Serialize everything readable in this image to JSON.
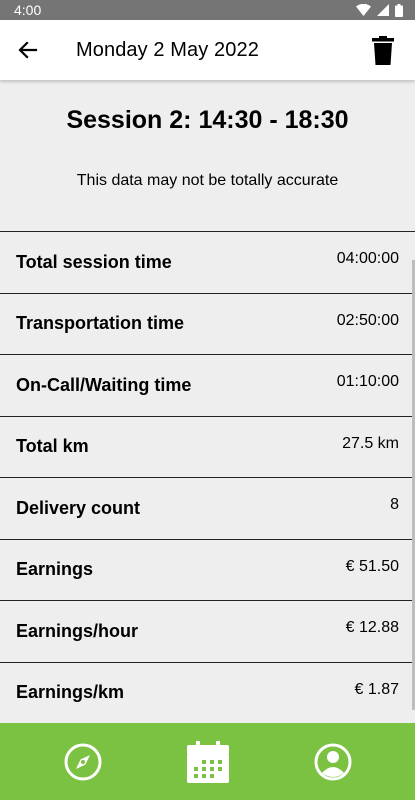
{
  "status_bar": {
    "time": "4:00",
    "icons": [
      "wifi-icon",
      "signal-icon",
      "battery-icon"
    ]
  },
  "app_bar": {
    "title": "Monday 2 May 2022",
    "back_icon": "arrow-left-icon",
    "delete_icon": "trash-icon"
  },
  "header": {
    "session_title": "Session 2: 14:30 - 18:30",
    "disclaimer": "This data may not be totally accurate"
  },
  "stats": [
    {
      "label": "Total session time",
      "value": "04:00:00"
    },
    {
      "label": "Transportation time",
      "value": "02:50:00"
    },
    {
      "label": "On-Call/Waiting time",
      "value": "01:10:00"
    },
    {
      "label": "Total km",
      "value": "27.5 km"
    },
    {
      "label": "Delivery count",
      "value": "8"
    },
    {
      "label": "Earnings",
      "value": "€ 51.50"
    },
    {
      "label": "Earnings/hour",
      "value": "€ 12.88"
    },
    {
      "label": "Earnings/km",
      "value": "€ 1.87"
    }
  ],
  "bottom_nav": {
    "items": [
      "compass-icon",
      "calendar-icon",
      "profile-icon"
    ],
    "accent_color": "#7bc142"
  }
}
